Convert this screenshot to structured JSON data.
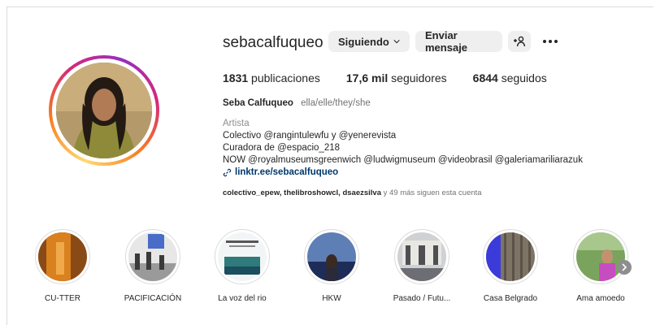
{
  "profile": {
    "username": "sebacalfuqueo",
    "following_label": "Siguiendo",
    "message_label": "Enviar mensaje",
    "stats": {
      "posts_count": "1831",
      "posts_label": "publicaciones",
      "followers_count": "17,6 mil",
      "followers_label": "seguidores",
      "following_count": "6844",
      "following_label": "seguidos"
    },
    "full_name": "Seba Calfuqueo",
    "pronouns": "ella/elle/they/she",
    "category": "Artista",
    "bio_lines": [
      "Colectivo @rangintulewfu y @yenerevista",
      "Curadora de @espacio_218",
      "NOW @royalmuseumsgreenwich @ludwigmuseum @videobrasil @galeriamariliarazuk"
    ],
    "link": "linktr.ee/sebacalfuqueo",
    "followed_by": {
      "names": "colectivo_epew, thelibroshowcl, dsaezsilva",
      "rest": " y 49 más siguen esta cuenta"
    }
  },
  "highlights": [
    {
      "label": "CU-TTER",
      "colors": [
        "#d9801f",
        "#8a4a16"
      ]
    },
    {
      "label": "PACIFICACIÓN",
      "colors": [
        "#e7e7e7",
        "#3a3a3a"
      ]
    },
    {
      "label": "La voz del rio",
      "colors": [
        "#f2f5f6",
        "#2f7a7a"
      ]
    },
    {
      "label": "HKW",
      "colors": [
        "#5e7fb5",
        "#1e2d57"
      ]
    },
    {
      "label": "Pasado / Futu...",
      "colors": [
        "#cfd2d4",
        "#4e4f53"
      ]
    },
    {
      "label": "Casa Belgrado",
      "colors": [
        "#3b3bd9",
        "#7d7465"
      ]
    },
    {
      "label": "Ama amoedo",
      "colors": [
        "#7aa35d",
        "#c64dc0"
      ]
    }
  ],
  "icons": {
    "chevron": "chevron-down-icon",
    "add_user": "add-user-icon",
    "more": "more-icon",
    "link": "link-icon",
    "next": "chevron-right-icon"
  },
  "colors": {
    "link": "#00376b",
    "button_bg": "#efefef",
    "muted": "#737373"
  }
}
